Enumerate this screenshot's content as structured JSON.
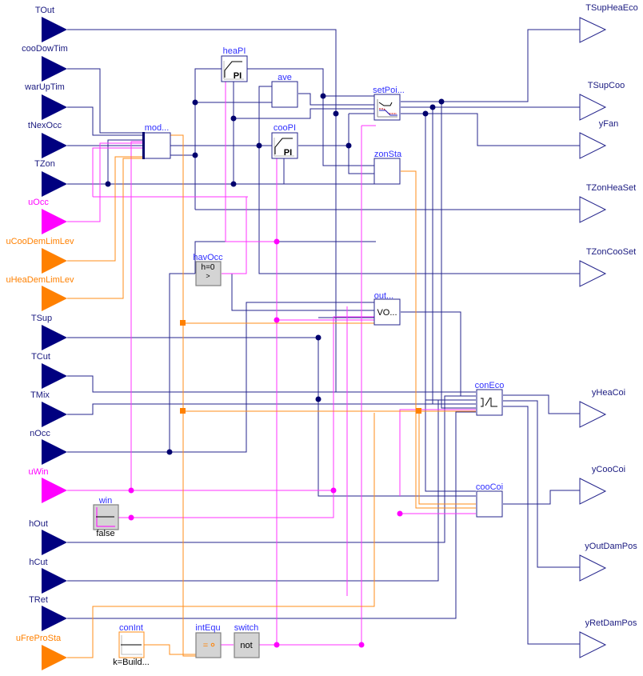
{
  "diagram": {
    "inputs": [
      {
        "name": "TOut",
        "kind": "real"
      },
      {
        "name": "cooDowTim",
        "kind": "real"
      },
      {
        "name": "warUpTim",
        "kind": "real"
      },
      {
        "name": "tNexOcc",
        "kind": "real"
      },
      {
        "name": "TZon",
        "kind": "real"
      },
      {
        "name": "uOcc",
        "kind": "boolean"
      },
      {
        "name": "uCooDemLimLev",
        "kind": "integer"
      },
      {
        "name": "uHeaDemLimLev",
        "kind": "integer"
      },
      {
        "name": "TSup",
        "kind": "real"
      },
      {
        "name": "TCut",
        "kind": "real"
      },
      {
        "name": "TMix",
        "kind": "real"
      },
      {
        "name": "nOcc",
        "kind": "real"
      },
      {
        "name": "uWin",
        "kind": "boolean"
      },
      {
        "name": "hOut",
        "kind": "real"
      },
      {
        "name": "hCut",
        "kind": "real"
      },
      {
        "name": "TRet",
        "kind": "real"
      },
      {
        "name": "uFreProSta",
        "kind": "integer"
      }
    ],
    "outputs": [
      {
        "name": "TSupHeaEco"
      },
      {
        "name": "TSupCoo"
      },
      {
        "name": "yFan"
      },
      {
        "name": "TZonHeaSet"
      },
      {
        "name": "TZonCooSet"
      },
      {
        "name": "yHeaCoi"
      },
      {
        "name": "yCooCoi"
      },
      {
        "name": "yOutDamPos"
      },
      {
        "name": "yRetDamPos"
      }
    ],
    "blocks": {
      "mod": {
        "label": "mod..."
      },
      "heaPI": {
        "label": "heaPI",
        "icon_text": "PI"
      },
      "ave": {
        "label": "ave"
      },
      "cooPI": {
        "label": "cooPI",
        "icon_text": "PI"
      },
      "setPoi": {
        "label": "setPoi..."
      },
      "zonSta": {
        "label": "zonSta"
      },
      "havOcc": {
        "label": "havOcc",
        "param": "h=0",
        "icon_text": ">"
      },
      "out": {
        "label": "out...",
        "icon_text": "VO..."
      },
      "conEco": {
        "label": "conEco"
      },
      "cooCoi": {
        "label": "cooCoi"
      },
      "win": {
        "label": "win",
        "param": "false"
      },
      "conInt": {
        "label": "conInt",
        "param": "k=Build..."
      },
      "intEqu": {
        "label": "intEqu",
        "icon_text": "="
      },
      "switch": {
        "label": "switch",
        "icon_text": "not"
      }
    },
    "colors": {
      "real": "#000080",
      "boolean": "#ff00ff",
      "integer": "#ff8000",
      "block_label": "#2f2fff",
      "wire_real": "#24248c"
    }
  }
}
